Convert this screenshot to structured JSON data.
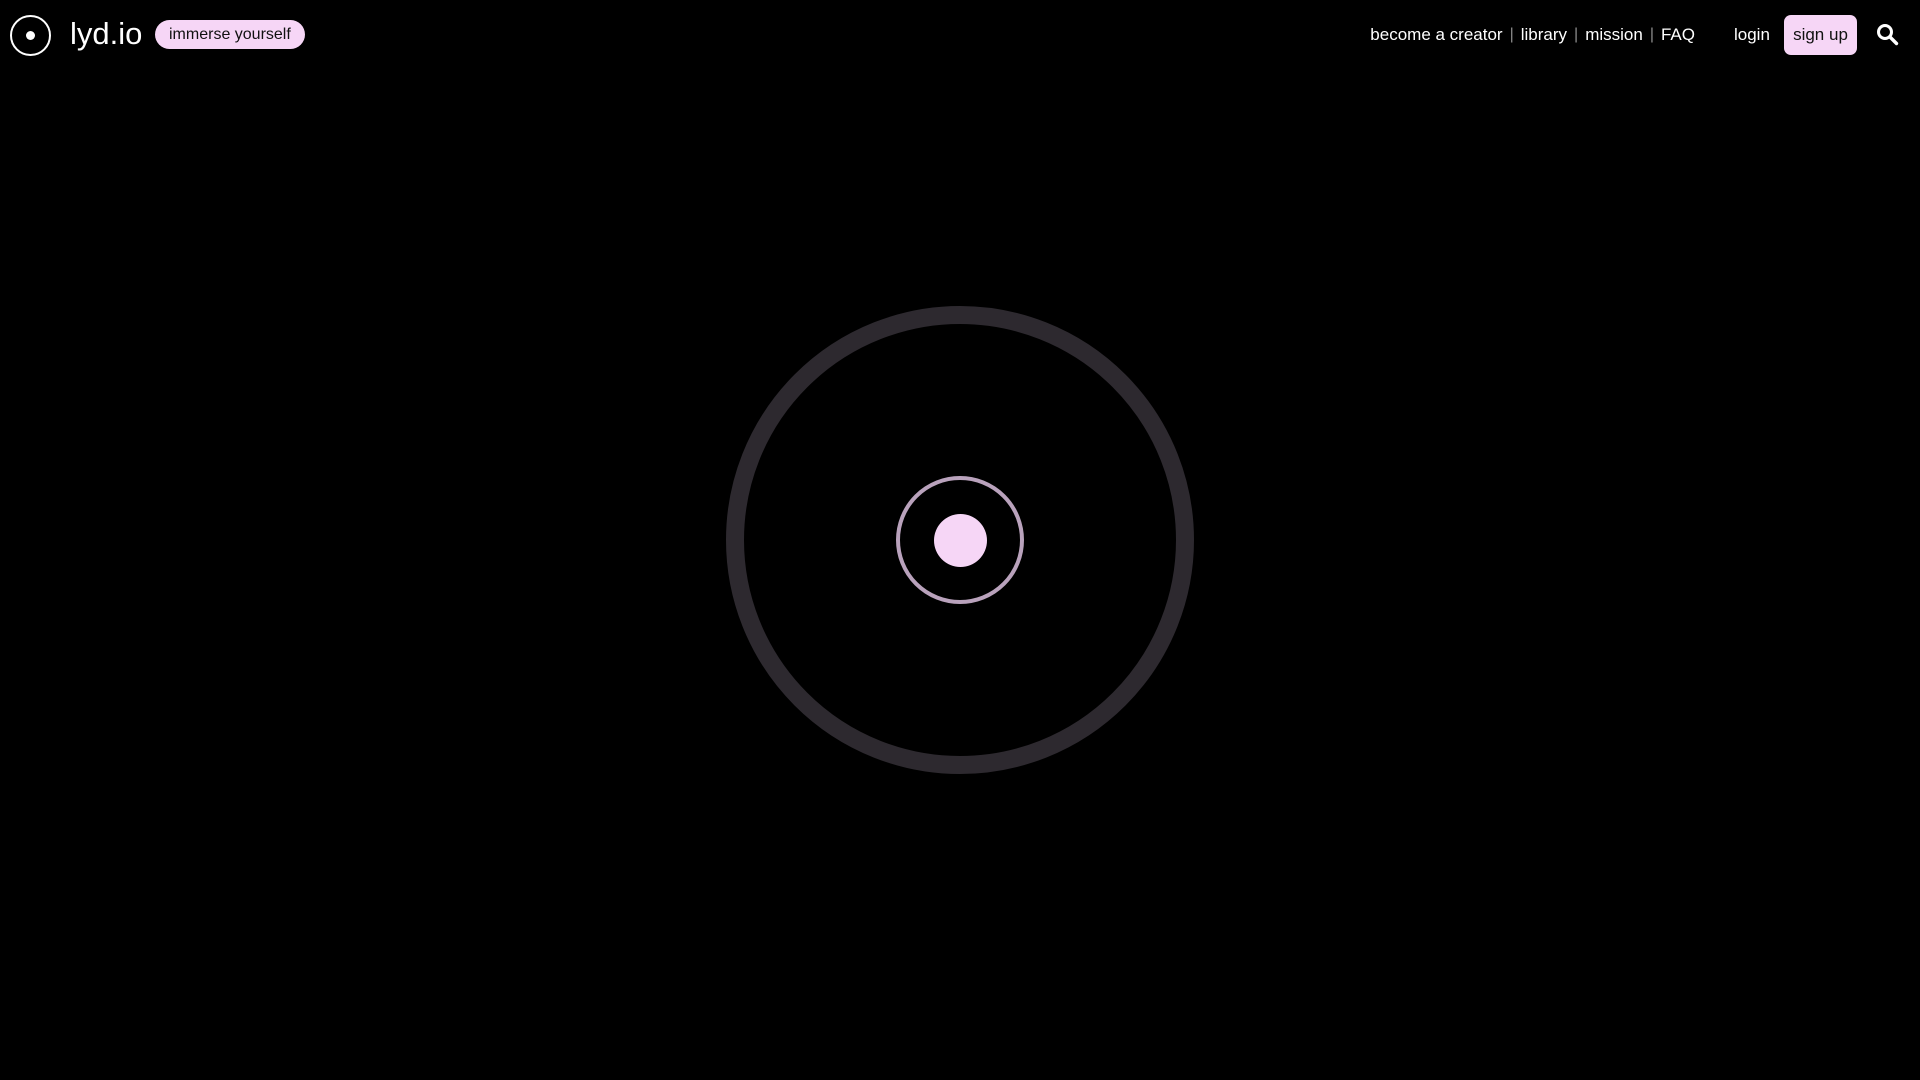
{
  "brand": {
    "name": "lyd.io",
    "tagline": "immerse yourself",
    "logo_icon": "circle-dot-icon"
  },
  "nav": {
    "items": [
      {
        "label": "become a creator"
      },
      {
        "label": "library"
      },
      {
        "label": "mission"
      },
      {
        "label": "FAQ"
      }
    ],
    "separator": "|"
  },
  "auth": {
    "login_label": "login",
    "signup_label": "sign up"
  },
  "search": {
    "icon": "search-icon"
  },
  "player": {
    "play_icon": "circle-dot-icon"
  },
  "colors": {
    "background": "#000000",
    "accent_pink": "#f6d6f6",
    "ring_dark": "#2d292f",
    "ring_mauve": "#b9a2bc",
    "text": "#ffffff"
  }
}
